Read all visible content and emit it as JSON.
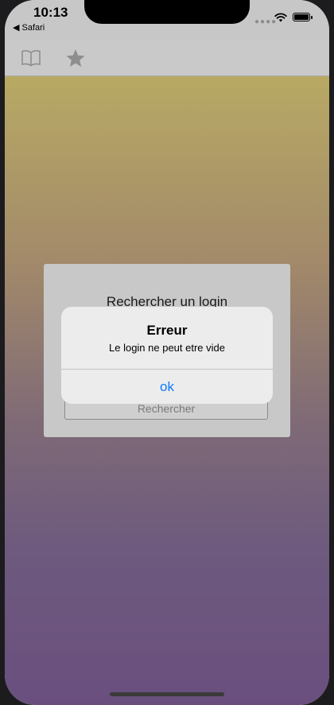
{
  "status_bar": {
    "time": "10:13",
    "back_app": "◀ Safari",
    "signal_glyph": "●●●●"
  },
  "toolbar": {
    "icons": [
      "book-icon",
      "star-icon"
    ]
  },
  "panel": {
    "title": "Rechercher un login",
    "search_button_label": "Rechercher"
  },
  "alert": {
    "title": "Erreur",
    "message": "Le login ne peut etre vide",
    "ok_label": "ok",
    "ok_color": "#0a7aff"
  }
}
